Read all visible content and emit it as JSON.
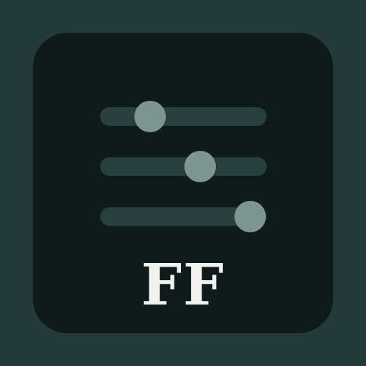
{
  "app_icon": {
    "monogram": "FF",
    "icon_name": "sliders-icon",
    "colors": {
      "background": "#24393a",
      "tile": "#0f1b1b",
      "track": "#27403d",
      "knob": "#7f9690",
      "monogram": "#f3f2ee"
    },
    "sliders": [
      {
        "level": 0.3
      },
      {
        "level": 0.6
      },
      {
        "level": 0.9
      }
    ]
  }
}
